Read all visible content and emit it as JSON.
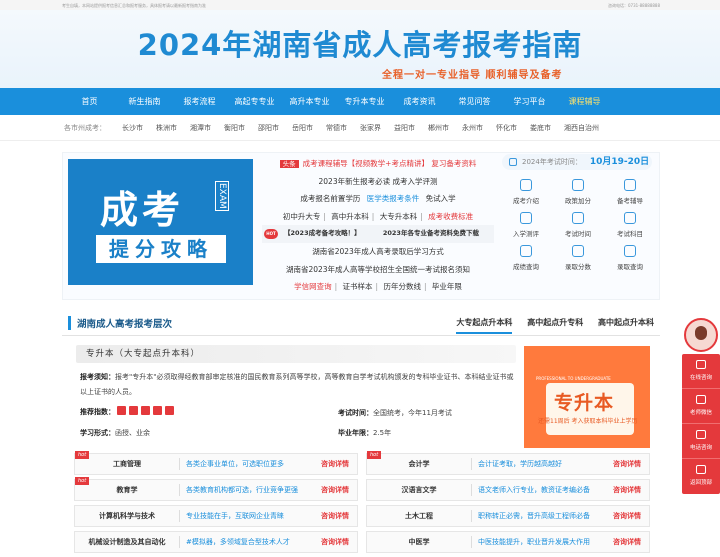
{
  "topbar": {
    "left": "考生自填，本网站提供报考信息汇总和报考服务，具体报考请以最新报考指南为准",
    "right": "咨询电话：0731-88888888"
  },
  "banner": {
    "title": "2024年湖南省成人高考报考指南",
    "slogan": "全程一对一专业指导   顺利辅导及备考"
  },
  "nav": [
    "首页",
    "新生指南",
    "报考流程",
    "高起专专业",
    "高升本专业",
    "专升本专业",
    "成考资讯",
    "常见问答",
    "学习平台",
    "课程辅导"
  ],
  "cities": {
    "label": "各市州成考：",
    "items": [
      "长沙市",
      "株洲市",
      "湘潭市",
      "衡阳市",
      "邵阳市",
      "岳阳市",
      "常德市",
      "张家界",
      "益阳市",
      "郴州市",
      "永州市",
      "怀化市",
      "娄底市",
      "湘西自治州"
    ]
  },
  "slide": {
    "big": "成考",
    "exam": "EXAM",
    "sub": "提分攻略"
  },
  "news": {
    "headline_tag": "头条",
    "headline": "成考课程辅导【视频教学+考点精讲】  复习备考资料",
    "r1": "2023年新生报考必读  成考入学评测",
    "r2a": "成考报名前置学历",
    "r2b": "医学类报考条件",
    "r2c": "免试入学",
    "r3a": "初中升大专",
    "r3b": "高中升本科",
    "r3c": "大专升本科",
    "r3d": "成考收费标准",
    "hot": "HOT",
    "band1": "【2023成考备考攻略！】",
    "band2": "2023年各专业备考资料免费下载",
    "r4": "湖南省2023年成人高考录取后学习方式",
    "r5": "湖南省2023年成人高等学校招生全国统一考试报名须知",
    "r6a": "学信网查询",
    "r6b": "证书样本",
    "r6c": "历年分数线",
    "r6d": "毕业年限",
    "sep": "|"
  },
  "panel": {
    "date_label": "2024年考试时间：",
    "date_value": "10月19-20日",
    "items": [
      "成考介绍",
      "政策加分",
      "备考辅导",
      "入学测评",
      "考试时间",
      "考试科目",
      "成绩查询",
      "录取分数",
      "录取查询"
    ]
  },
  "section": {
    "title": "湖南成人高考报考层次",
    "tabs": [
      "大专起点升本科",
      "高中起点升专科",
      "高中起点升本科"
    ]
  },
  "level": {
    "title": "专升本（大专起点升本科）",
    "desc_label": "报考须知：",
    "desc": "报考\"专升本\"必须取得经教育部审定核准的国民教育系列高等学校，高等教育自学考试机构颁发的专科毕业证书、本科结业证书或以上证书的人员。",
    "rec_label": "推荐指数：",
    "stars": 5,
    "time_label": "考试时间：",
    "time_value": "全国统考，今年11月考试",
    "form_label": "学习形式：",
    "form_value": "函授、业余",
    "years_label": "毕业年限：",
    "years_value": "2.5年"
  },
  "poster": {
    "small": "PROFESSIONAL TO UNDERGRADUATE",
    "title": "专升本",
    "sub": "还需11周后  考入获取本科毕业上学历"
  },
  "majors": [
    [
      {
        "hot": "hot",
        "name": "工商管理",
        "desc": "各类企事业单位，可选职位更多",
        "cta": "咨询详情"
      },
      {
        "hot": "hot",
        "name": "会计学",
        "desc": "会计证考取，学历越高越好",
        "cta": "咨询详情"
      }
    ],
    [
      {
        "hot": "hot",
        "name": "教育学",
        "desc": "各类教育机构都可选，行业竞争更强",
        "cta": "咨询详情"
      },
      {
        "hot": "",
        "name": "汉语言文学",
        "desc": "语文老师入行专业，教资证考编必备",
        "cta": "咨询详情"
      }
    ],
    [
      {
        "hot": "",
        "name": "计算机科学与技术",
        "desc": "专业技能在手，互联网企业青睐",
        "cta": "咨询详情"
      },
      {
        "hot": "",
        "name": "土木工程",
        "desc": "职称转正必需，晋升高级工程师必备",
        "cta": "咨询详情"
      }
    ],
    [
      {
        "hot": "",
        "name": "机械设计制造及其自动化",
        "desc": "#模拟器，多领域复合型技术人才",
        "cta": "咨询详情"
      },
      {
        "hot": "",
        "name": "中医学",
        "desc": "中医技能提升，职业晋升发展大作用",
        "cta": "咨询详情"
      }
    ]
  ],
  "float": [
    "在线咨询",
    "老师微信",
    "电话咨询",
    "返回顶部"
  ]
}
